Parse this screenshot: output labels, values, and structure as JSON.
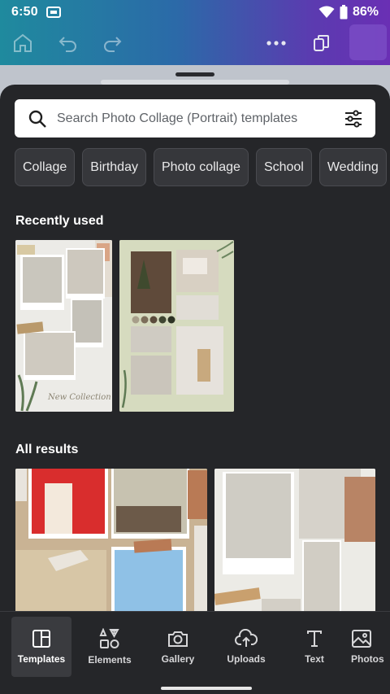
{
  "status": {
    "time": "6:50",
    "battery": "86%"
  },
  "toolbar": {
    "home_icon": "home-icon",
    "undo_icon": "undo-icon",
    "redo_icon": "redo-icon",
    "more_icon": "more-dots-icon",
    "pages_icon": "pages-icon"
  },
  "search": {
    "placeholder": "Search Photo Collage (Portrait) templates",
    "value": ""
  },
  "chips": [
    "Collage",
    "Birthday",
    "Photo collage",
    "School",
    "Wedding"
  ],
  "sections": {
    "recent": "Recently used",
    "all": "All results"
  },
  "recent_templates": [
    {
      "caption": "New Collection"
    },
    {
      "caption": ""
    }
  ],
  "nav": [
    {
      "label": "Templates",
      "icon": "templates-icon",
      "active": true
    },
    {
      "label": "Elements",
      "icon": "elements-icon",
      "active": false
    },
    {
      "label": "Gallery",
      "icon": "camera-icon",
      "active": false
    },
    {
      "label": "Uploads",
      "icon": "upload-cloud-icon",
      "active": false
    },
    {
      "label": "Text",
      "icon": "text-icon",
      "active": false
    },
    {
      "label": "Photos",
      "icon": "image-icon",
      "active": false
    }
  ],
  "colors": {
    "accent_gradient_start": "#1f8a9e",
    "accent_gradient_end": "#6a2fb4",
    "sheet": "#252629"
  }
}
